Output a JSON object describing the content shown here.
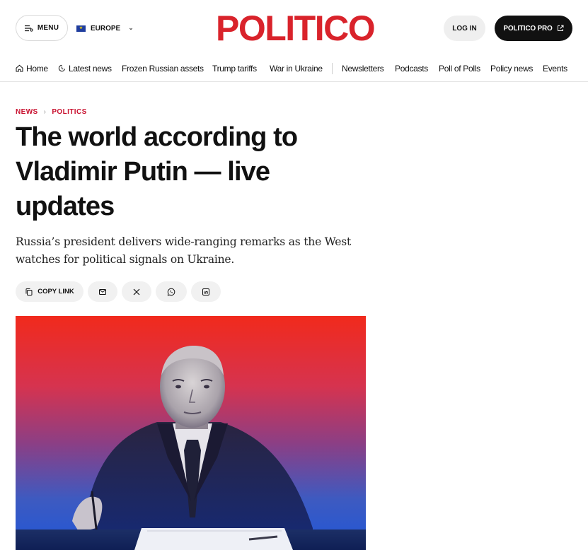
{
  "header": {
    "menu_label": "MENU",
    "region_label": "EUROPE",
    "logo_text": "POLITICO",
    "login_label": "LOG IN",
    "pro_label": "POLITICO PRO",
    "brand_color": "#d9232b"
  },
  "nav": {
    "items": [
      {
        "label": "Home",
        "icon": "home-icon"
      },
      {
        "label": "Latest news",
        "icon": "clock-icon"
      },
      {
        "label": "Frozen Russian assets"
      },
      {
        "label": "Trump tariffs"
      },
      {
        "label": "War in Ukraine"
      },
      {
        "label": "Newsletters"
      },
      {
        "label": "Podcasts"
      },
      {
        "label": "Poll of Polls"
      },
      {
        "label": "Policy news"
      },
      {
        "label": "Events"
      }
    ]
  },
  "article": {
    "breadcrumb": [
      "NEWS",
      "POLITICS"
    ],
    "headline": "The world according to Vladimir Putin — live updates",
    "dek": "Russia’s president delivers wide-ranging remarks as the West watches for political signals on Ukraine.",
    "accent_color": "#c8102e"
  },
  "share": {
    "copy_link_label": "COPY LINK",
    "icons": [
      "email-icon",
      "x-icon",
      "whatsapp-icon",
      "linkedin-icon"
    ]
  },
  "hero": {
    "image_subject": "portrait-photo",
    "gradient_colors": [
      "#f12a1c",
      "#8a3f86",
      "#1f57d8"
    ]
  }
}
